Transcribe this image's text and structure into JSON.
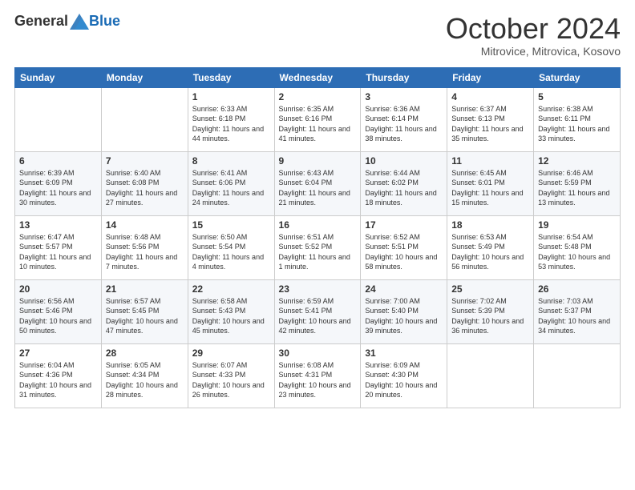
{
  "header": {
    "logo_general": "General",
    "logo_blue": "Blue",
    "month_title": "October 2024",
    "location": "Mitrovice, Mitrovica, Kosovo"
  },
  "days_of_week": [
    "Sunday",
    "Monday",
    "Tuesday",
    "Wednesday",
    "Thursday",
    "Friday",
    "Saturday"
  ],
  "weeks": [
    [
      {
        "day": "",
        "info": ""
      },
      {
        "day": "",
        "info": ""
      },
      {
        "day": "1",
        "info": "Sunrise: 6:33 AM\nSunset: 6:18 PM\nDaylight: 11 hours and 44 minutes."
      },
      {
        "day": "2",
        "info": "Sunrise: 6:35 AM\nSunset: 6:16 PM\nDaylight: 11 hours and 41 minutes."
      },
      {
        "day": "3",
        "info": "Sunrise: 6:36 AM\nSunset: 6:14 PM\nDaylight: 11 hours and 38 minutes."
      },
      {
        "day": "4",
        "info": "Sunrise: 6:37 AM\nSunset: 6:13 PM\nDaylight: 11 hours and 35 minutes."
      },
      {
        "day": "5",
        "info": "Sunrise: 6:38 AM\nSunset: 6:11 PM\nDaylight: 11 hours and 33 minutes."
      }
    ],
    [
      {
        "day": "6",
        "info": "Sunrise: 6:39 AM\nSunset: 6:09 PM\nDaylight: 11 hours and 30 minutes."
      },
      {
        "day": "7",
        "info": "Sunrise: 6:40 AM\nSunset: 6:08 PM\nDaylight: 11 hours and 27 minutes."
      },
      {
        "day": "8",
        "info": "Sunrise: 6:41 AM\nSunset: 6:06 PM\nDaylight: 11 hours and 24 minutes."
      },
      {
        "day": "9",
        "info": "Sunrise: 6:43 AM\nSunset: 6:04 PM\nDaylight: 11 hours and 21 minutes."
      },
      {
        "day": "10",
        "info": "Sunrise: 6:44 AM\nSunset: 6:02 PM\nDaylight: 11 hours and 18 minutes."
      },
      {
        "day": "11",
        "info": "Sunrise: 6:45 AM\nSunset: 6:01 PM\nDaylight: 11 hours and 15 minutes."
      },
      {
        "day": "12",
        "info": "Sunrise: 6:46 AM\nSunset: 5:59 PM\nDaylight: 11 hours and 13 minutes."
      }
    ],
    [
      {
        "day": "13",
        "info": "Sunrise: 6:47 AM\nSunset: 5:57 PM\nDaylight: 11 hours and 10 minutes."
      },
      {
        "day": "14",
        "info": "Sunrise: 6:48 AM\nSunset: 5:56 PM\nDaylight: 11 hours and 7 minutes."
      },
      {
        "day": "15",
        "info": "Sunrise: 6:50 AM\nSunset: 5:54 PM\nDaylight: 11 hours and 4 minutes."
      },
      {
        "day": "16",
        "info": "Sunrise: 6:51 AM\nSunset: 5:52 PM\nDaylight: 11 hours and 1 minute."
      },
      {
        "day": "17",
        "info": "Sunrise: 6:52 AM\nSunset: 5:51 PM\nDaylight: 10 hours and 58 minutes."
      },
      {
        "day": "18",
        "info": "Sunrise: 6:53 AM\nSunset: 5:49 PM\nDaylight: 10 hours and 56 minutes."
      },
      {
        "day": "19",
        "info": "Sunrise: 6:54 AM\nSunset: 5:48 PM\nDaylight: 10 hours and 53 minutes."
      }
    ],
    [
      {
        "day": "20",
        "info": "Sunrise: 6:56 AM\nSunset: 5:46 PM\nDaylight: 10 hours and 50 minutes."
      },
      {
        "day": "21",
        "info": "Sunrise: 6:57 AM\nSunset: 5:45 PM\nDaylight: 10 hours and 47 minutes."
      },
      {
        "day": "22",
        "info": "Sunrise: 6:58 AM\nSunset: 5:43 PM\nDaylight: 10 hours and 45 minutes."
      },
      {
        "day": "23",
        "info": "Sunrise: 6:59 AM\nSunset: 5:41 PM\nDaylight: 10 hours and 42 minutes."
      },
      {
        "day": "24",
        "info": "Sunrise: 7:00 AM\nSunset: 5:40 PM\nDaylight: 10 hours and 39 minutes."
      },
      {
        "day": "25",
        "info": "Sunrise: 7:02 AM\nSunset: 5:39 PM\nDaylight: 10 hours and 36 minutes."
      },
      {
        "day": "26",
        "info": "Sunrise: 7:03 AM\nSunset: 5:37 PM\nDaylight: 10 hours and 34 minutes."
      }
    ],
    [
      {
        "day": "27",
        "info": "Sunrise: 6:04 AM\nSunset: 4:36 PM\nDaylight: 10 hours and 31 minutes."
      },
      {
        "day": "28",
        "info": "Sunrise: 6:05 AM\nSunset: 4:34 PM\nDaylight: 10 hours and 28 minutes."
      },
      {
        "day": "29",
        "info": "Sunrise: 6:07 AM\nSunset: 4:33 PM\nDaylight: 10 hours and 26 minutes."
      },
      {
        "day": "30",
        "info": "Sunrise: 6:08 AM\nSunset: 4:31 PM\nDaylight: 10 hours and 23 minutes."
      },
      {
        "day": "31",
        "info": "Sunrise: 6:09 AM\nSunset: 4:30 PM\nDaylight: 10 hours and 20 minutes."
      },
      {
        "day": "",
        "info": ""
      },
      {
        "day": "",
        "info": ""
      }
    ]
  ]
}
